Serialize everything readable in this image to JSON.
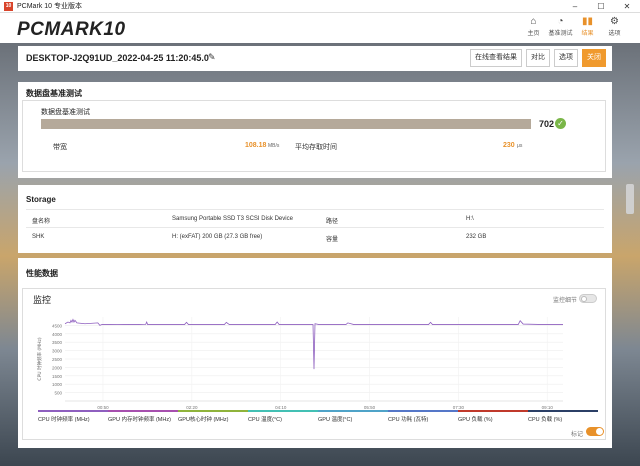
{
  "window": {
    "app_icon": "10",
    "title": "PCMark 10 专业版本",
    "controls": [
      "–",
      "☐",
      "✕"
    ]
  },
  "brand": {
    "logo": "PCMARK",
    "logo_num": "10"
  },
  "nav": [
    {
      "icon": "home-icon",
      "glyph": "⌂",
      "label": "主页"
    },
    {
      "icon": "gauge-icon",
      "glyph": "◔",
      "label": "基准测试"
    },
    {
      "icon": "bar-chart-icon",
      "glyph": "▮▮",
      "label": "结果"
    },
    {
      "icon": "gear-icon",
      "glyph": "⚙",
      "label": "选项"
    }
  ],
  "run": {
    "name": "DESKTOP-J2Q91UD_2022-04-25 11:20:45.0",
    "buttons": {
      "online": "在线查看结果",
      "compare": "对比",
      "options": "选项",
      "close": "关闭"
    }
  },
  "storage_benchmark": {
    "section_title": "数据盘基准测试",
    "card_title": "数据盘基准测试",
    "score": "702",
    "score_fill": 1.0,
    "bandwidth_label": "带宽",
    "bandwidth_value": "108.18",
    "bandwidth_unit": "MB/s",
    "access_label": "平均存取时间",
    "access_value": "230",
    "access_unit": "μs"
  },
  "storage": {
    "section_title": "Storage",
    "rows": [
      {
        "k1": "盘名称",
        "v1": "Samsung Portable SSD T3 SCSI Disk Device",
        "k2": "路径",
        "v2": "H:\\"
      },
      {
        "k1": "SHK",
        "v1": "H: (exFAT) 200 GB (27.3 GB free)",
        "k2": "容量",
        "v2": "232 GB"
      }
    ]
  },
  "performance": {
    "section_title": "性能数据",
    "monitor_title": "监控",
    "detail_label": "监控细节",
    "marker_label": "标记",
    "legend": [
      {
        "label": "CPU 时钟频率 (MHz)",
        "color": "#8e5fbf"
      },
      {
        "label": "GPU 内存时钟频率 (MHz)",
        "color": "#a64fae"
      },
      {
        "label": "GPU核心时钟 (MHz)",
        "color": "#8fb33b"
      },
      {
        "label": "CPU 温度(°C)",
        "color": "#43c0b4"
      },
      {
        "label": "GPU 温度(°C)",
        "color": "#4fa3c8"
      },
      {
        "label": "CPU 功耗 (瓦特)",
        "color": "#5577c8"
      },
      {
        "label": "GPU 负载 (%)",
        "color": "#c0392b"
      },
      {
        "label": "CPU 负载 (%)",
        "color": "#2b3f66"
      }
    ]
  },
  "chart_data": {
    "type": "line",
    "ylabel": "CPU 时钟频率 (MHz)",
    "ylim": [
      0,
      5000
    ],
    "yticks": [
      "500",
      "1000",
      "1500",
      "2000",
      "2500",
      "3000",
      "3500",
      "4000",
      "4500"
    ],
    "xticks": [
      "00:50",
      "02:20",
      "04:10",
      "05:50",
      "07:30",
      "09:10"
    ],
    "series": [
      {
        "color": "#8e5fbf",
        "x": [
          0,
          3,
          5,
          6,
          7,
          8,
          9,
          10,
          12,
          20,
          33,
          35,
          37,
          45,
          60,
          75,
          81,
          82,
          83,
          90,
          110,
          120,
          122,
          124,
          130,
          150,
          160,
          162,
          165,
          180,
          200,
          211,
          213,
          215,
          225,
          240,
          249,
          250,
          251,
          255,
          270,
          282,
          284,
          290,
          310,
          320,
          340,
          365,
          367,
          369,
          380,
          400,
          420,
          440,
          455,
          457,
          460,
          480,
          490,
          500
        ],
        "y": [
          4600,
          4700,
          4650,
          4800,
          4700,
          4850,
          4700,
          4800,
          4650,
          4600,
          4650,
          4500,
          4550,
          4550,
          4560,
          4550,
          4560,
          4700,
          4550,
          4550,
          4550,
          4550,
          4680,
          4550,
          4550,
          4550,
          4550,
          4680,
          4550,
          4550,
          4550,
          4550,
          4700,
          4550,
          4550,
          4550,
          4550,
          1900,
          4600,
          4550,
          4550,
          4550,
          4650,
          4550,
          4550,
          4550,
          4550,
          4550,
          4680,
          4550,
          4550,
          4550,
          4550,
          4550,
          4550,
          4780,
          4580,
          4550,
          4550,
          4550
        ]
      }
    ]
  }
}
